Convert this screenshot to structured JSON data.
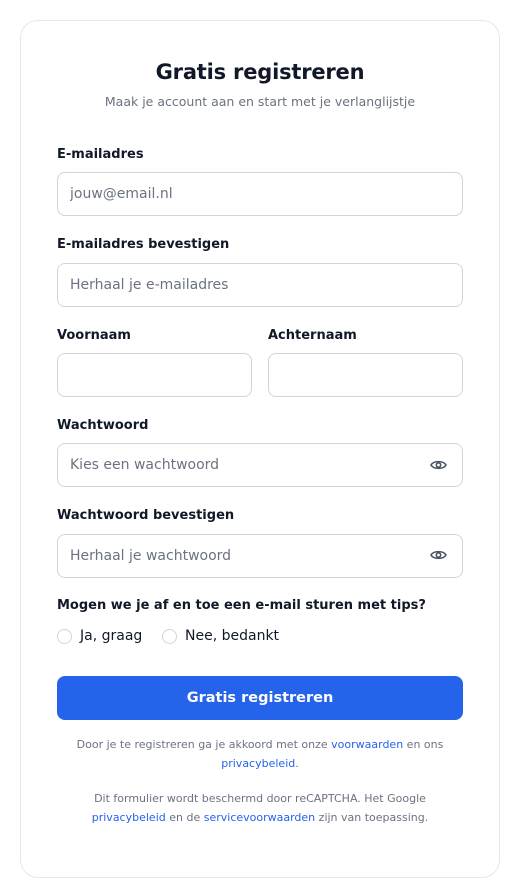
{
  "form": {
    "title": "Gratis registreren",
    "subtitle": "Maak je account aan en start met je verlanglijstje",
    "email": {
      "label": "E-mailadres",
      "placeholder": "jouw@email.nl",
      "value": ""
    },
    "email_confirm": {
      "label": "E-mailadres bevestigen",
      "placeholder": "Herhaal je e-mailadres",
      "value": ""
    },
    "first_name": {
      "label": "Voornaam",
      "placeholder": "",
      "value": ""
    },
    "last_name": {
      "label": "Achternaam",
      "placeholder": "",
      "value": ""
    },
    "password": {
      "label": "Wachtwoord",
      "placeholder": "Kies een wachtwoord",
      "value": "",
      "icon": "eye-icon"
    },
    "password_confirm": {
      "label": "Wachtwoord bevestigen",
      "placeholder": "Herhaal je wachtwoord",
      "value": "",
      "icon": "eye-icon"
    },
    "newsletter": {
      "question": "Mogen we je af en toe een e-mail sturen met tips?",
      "options": [
        {
          "label": "Ja, graag",
          "selected": false
        },
        {
          "label": "Nee, bedankt",
          "selected": false
        }
      ]
    },
    "submit_label": "Gratis registreren"
  },
  "legal": {
    "terms_prefix": "Door je te registreren ga je akkoord met onze",
    "terms_link": "voorwaarden",
    "terms_middle": "en ons",
    "privacy_link": "privacybeleid",
    "terms_suffix": ".",
    "recaptcha_prefix": "Dit formulier wordt beschermd door reCAPTCHA. Het Google",
    "google_privacy_link": "privacybeleid",
    "recaptcha_middle": "en de",
    "google_terms_link": "servicevoorwaarden",
    "recaptcha_suffix": "zijn van toepassing."
  },
  "colors": {
    "accent": "#2563eb",
    "border": "#d1d5db",
    "muted_text": "#6b7280"
  }
}
